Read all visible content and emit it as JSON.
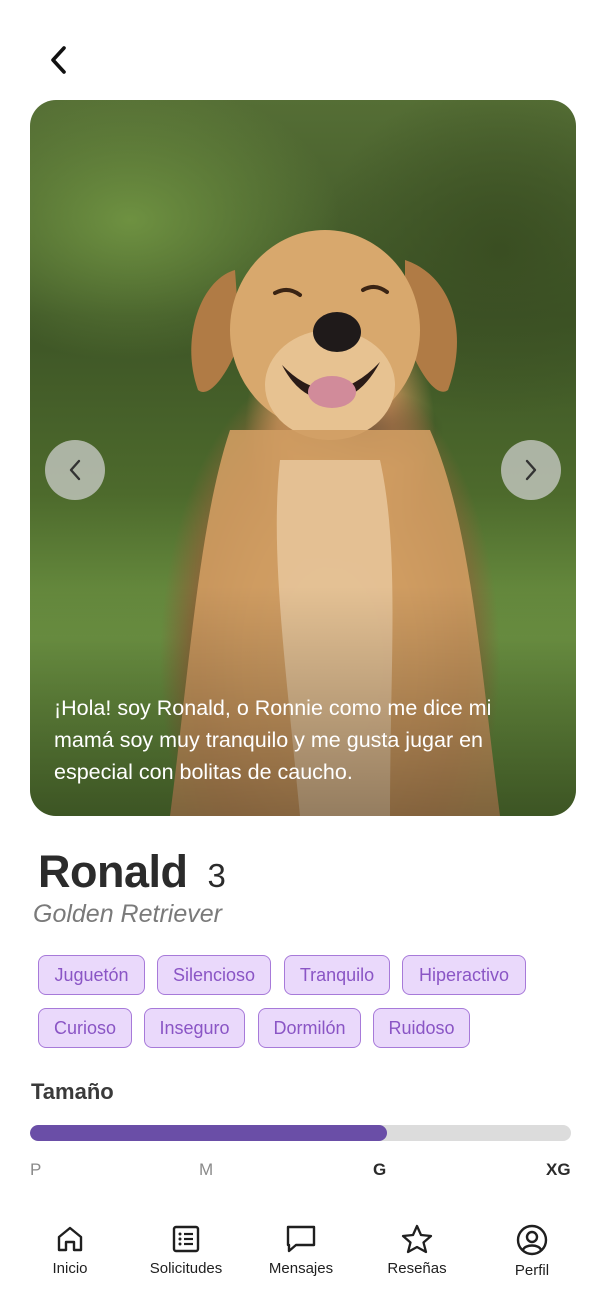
{
  "header": {
    "back_icon": "chevron-left-icon"
  },
  "gallery": {
    "caption": "¡Hola! soy Ronald, o Ronnie como me dice mi mamá soy muy tranquilo y me gusta jugar en especial con bolitas de caucho.",
    "prev_icon": "chevron-left-icon",
    "next_icon": "chevron-right-icon"
  },
  "pet": {
    "name": "Ronald",
    "age": "3",
    "breed": "Golden Retriever"
  },
  "tags": [
    "Juguetón",
    "Silencioso",
    "Tranquilo",
    "Hiperactivo",
    "Curioso",
    "Inseguro",
    "Dormilón",
    "Ruidoso"
  ],
  "size": {
    "title": "Tamaño",
    "labels": [
      "P",
      "M",
      "G",
      "XG"
    ],
    "selected": "G",
    "level_fraction": 0.66,
    "fill_color": "#6a4ea7",
    "track_color": "#dcdcdc"
  },
  "tag_style": {
    "background": "#ead9fb",
    "border": "#a77ad9",
    "text": "#8a55c5"
  },
  "bottom_nav": {
    "items": [
      {
        "label": "Inicio",
        "icon": "home-icon"
      },
      {
        "label": "Solicitudes",
        "icon": "list-icon"
      },
      {
        "label": "Mensajes",
        "icon": "message-icon"
      },
      {
        "label": "Reseñas",
        "icon": "star-icon"
      },
      {
        "label": "Perfil",
        "icon": "user-circle-icon"
      }
    ]
  }
}
